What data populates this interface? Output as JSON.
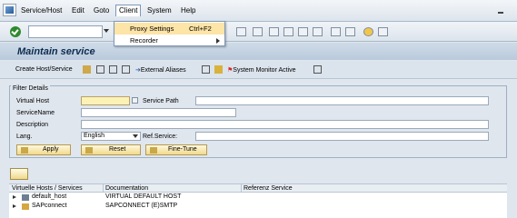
{
  "menubar": {
    "items": [
      "Service/Host",
      "Edit",
      "Goto",
      "Client",
      "System",
      "Help"
    ],
    "active": "Client"
  },
  "client_menu": {
    "items": [
      {
        "label": "Proxy Settings",
        "shortcut": "Ctrl+F2"
      },
      {
        "label": "Recorder",
        "shortcut": ""
      }
    ]
  },
  "page": {
    "title": "Maintain service"
  },
  "app_toolbar": {
    "create_label": "Create Host/Service",
    "external_aliases_label": "External Aliases",
    "system_monitor_label": "System Monitor Active"
  },
  "filter": {
    "group_title": "Filter Details",
    "virtual_host_label": "Virtual Host",
    "virtual_host_value": "",
    "service_path_label": "Service Path",
    "service_path_value": "",
    "service_name_label": "ServiceName",
    "service_name_value": "",
    "description_label": "Description",
    "description_value": "",
    "lang_label": "Lang.",
    "lang_value": "English",
    "ref_service_label": "Ref.Service:",
    "ref_service_value": "",
    "apply_label": "Apply",
    "reset_label": "Reset",
    "finetune_label": "Fine-Tune"
  },
  "tree": {
    "columns": [
      "Virtuelle Hosts / Services",
      "Documentation",
      "Referenz Service"
    ],
    "rows": [
      {
        "name": "default_host",
        "doc": "VIRTUAL DEFAULT HOST"
      },
      {
        "name": "SAPconnect",
        "doc": "SAPCONNECT (E)SMTP"
      }
    ]
  },
  "colors": {
    "menu_highlight": "#fde4a7",
    "title_text": "#0d2b4e",
    "required_field": "#fdf2b6",
    "button_gold": "#f2d98a",
    "monitor_red": "#d42a2a"
  }
}
